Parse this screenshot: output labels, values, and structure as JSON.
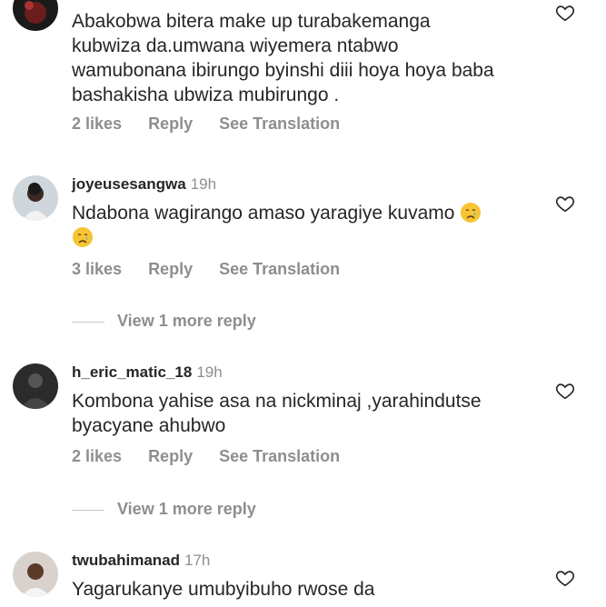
{
  "comments": [
    {
      "username": "",
      "time": "",
      "lines": [
        "Abakobwa bitera make up turabakemanga",
        "kubwiza da.umwana wiyemera ntabwo",
        "wamubonana ibirungo byinshi diii hoya hoya baba",
        "bashakisha ubwiza mubirungo ."
      ],
      "likes": "2 likes",
      "reply": "Reply",
      "translate": "See Translation",
      "avatar_icon": "avatar-dark-red"
    },
    {
      "username": "joyeusesangwa",
      "time": "19h",
      "lines": [
        "Ndabona wagirango amaso yaragiye kuvamo"
      ],
      "emoji": "crying-face-emoji",
      "likes": "3 likes",
      "reply": "Reply",
      "translate": "See Translation",
      "more_replies": "View 1 more reply"
    },
    {
      "username": "h_eric_matic_18",
      "time": "19h",
      "lines": [
        "Kombona yahise asa na nickminaj ,yarahindutse",
        "byacyane ahubwo"
      ],
      "likes": "2 likes",
      "reply": "Reply",
      "translate": "See Translation",
      "more_replies": "View 1 more reply"
    },
    {
      "username": "twubahimanad",
      "time": "17h",
      "lines": [
        "Yagarukanye umubyibuho rwose da"
      ]
    }
  ],
  "colors": {
    "text": "#262626",
    "muted": "#8e8e8e"
  }
}
